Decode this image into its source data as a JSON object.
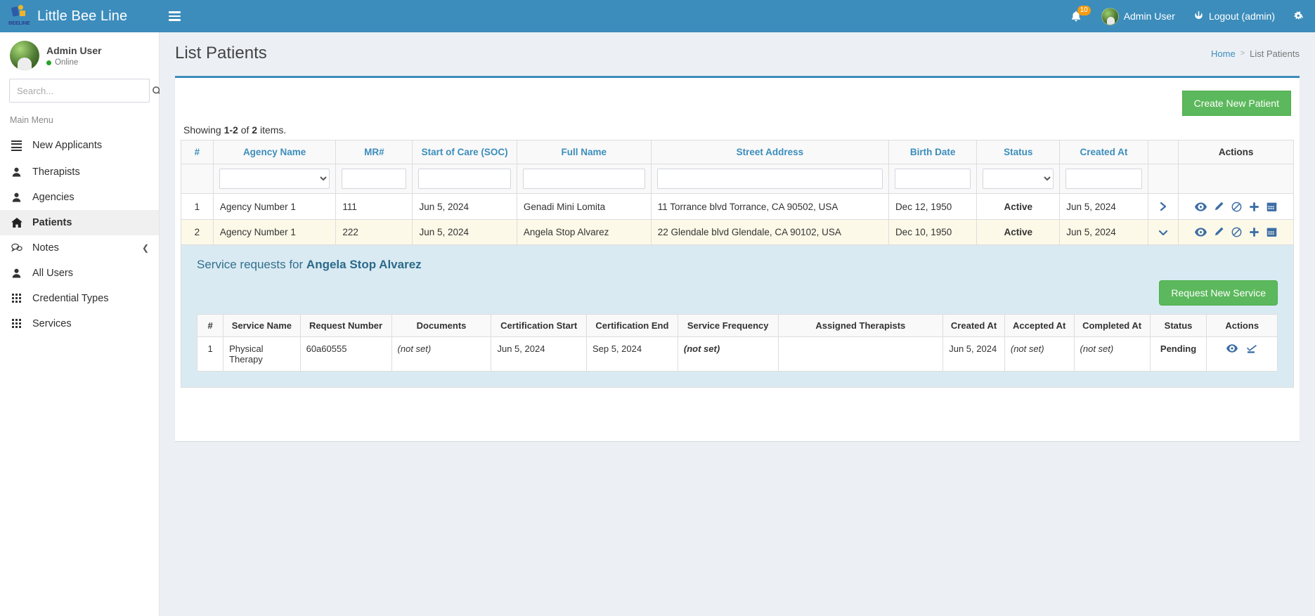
{
  "navbar": {
    "brand": "Little Bee Line",
    "logo_text": "BEELINE",
    "toggle_icon": "hamburger-icon",
    "notifications": {
      "icon": "bell-icon",
      "count": "10"
    },
    "user_name": "Admin User",
    "logout_label": "Logout (admin)",
    "logout_icon": "power-icon",
    "settings_icon": "gears-icon"
  },
  "sidebar": {
    "user": {
      "name": "Admin User",
      "status": "Online"
    },
    "search": {
      "placeholder": "Search...",
      "value": "",
      "icon": "search-icon"
    },
    "menu_header": "Main Menu",
    "items": [
      {
        "label": "New Applicants",
        "icon": "list-icon",
        "active": false
      },
      {
        "label": "Therapists",
        "icon": "user-icon",
        "active": false
      },
      {
        "label": "Agencies",
        "icon": "user-icon",
        "active": false
      },
      {
        "label": "Patients",
        "icon": "home-icon",
        "active": true
      },
      {
        "label": "Notes",
        "icon": "comments-icon",
        "active": false,
        "caret": "chevron-left-icon"
      },
      {
        "label": "All Users",
        "icon": "user-icon",
        "active": false
      },
      {
        "label": "Credential Types",
        "icon": "grid-icon",
        "active": false
      },
      {
        "label": "Services",
        "icon": "grid-icon",
        "active": false
      }
    ]
  },
  "page": {
    "title": "List Patients",
    "breadcrumb": {
      "home": "Home",
      "separator": ">",
      "current": "List Patients"
    }
  },
  "toolbar": {
    "create_label": "Create New Patient"
  },
  "summary": {
    "prefix": "Showing",
    "range": "1-2",
    "middle": "of",
    "total": "2",
    "suffix": "items."
  },
  "table": {
    "headers": [
      "#",
      "Agency Name",
      "MR#",
      "Start of Care (SOC)",
      "Full Name",
      "Street Address",
      "Birth Date",
      "Status",
      "Created At",
      "",
      "Actions"
    ],
    "filters": {
      "agency_name_value": "",
      "mr_value": "",
      "soc_value": "",
      "full_name_value": "",
      "street_value": "",
      "birth_value": "",
      "status_value": "",
      "created_value": ""
    },
    "rows": [
      {
        "num": "1",
        "agency": "Agency Number 1",
        "mr": "111",
        "soc": "Jun 5, 2024",
        "full_name": "Genadi Mini Lomita",
        "address": "11 Torrance blvd Torrance, CA 90502, USA",
        "birth": "Dec 12, 1950",
        "status": "Active",
        "created": "Jun 5, 2024",
        "expand_icon": "chevron-right-icon",
        "expanded": false
      },
      {
        "num": "2",
        "agency": "Agency Number 1",
        "mr": "222",
        "soc": "Jun 5, 2024",
        "full_name": "Angela Stop Alvarez",
        "address": "22 Glendale blvd Glendale, CA 90102, USA",
        "birth": "Dec 10, 1950",
        "status": "Active",
        "created": "Jun 5, 2024",
        "expand_icon": "chevron-down-icon",
        "expanded": true
      }
    ],
    "row_action_icons": [
      "eye-icon",
      "pencil-icon",
      "ban-icon",
      "plus-icon",
      "calendar-icon"
    ]
  },
  "subpanel": {
    "title_prefix": "Service requests for",
    "title_name": "Angela Stop Alvarez",
    "request_button": "Request New Service",
    "headers": [
      "#",
      "Service Name",
      "Request Number",
      "Documents",
      "Certification Start",
      "Certification End",
      "Service Frequency",
      "Assigned Therapists",
      "Created At",
      "Accepted At",
      "Completed At",
      "Status",
      "Actions"
    ],
    "rows": [
      {
        "num": "1",
        "service_name": "Physical Therapy",
        "request_number": "60a60555",
        "documents": "(not set)",
        "cert_start": "Jun 5, 2024",
        "cert_end": "Sep 5, 2024",
        "frequency": "(not set)",
        "therapists": "",
        "created_at": "Jun 5, 2024",
        "accepted_at": "(not set)",
        "completed_at": "(not set)",
        "status": "Pending"
      }
    ],
    "row_action_icons": [
      "eye-icon",
      "accept-check-icon"
    ]
  },
  "colors": {
    "navbar": "#3c8dbc",
    "accent": "#3c8dbc",
    "green_button": "#5cb85c",
    "status_active": "#00a65a",
    "not_set": "#c9302c",
    "subpanel_bg": "#daeaf2",
    "badge": "#f39c12"
  }
}
